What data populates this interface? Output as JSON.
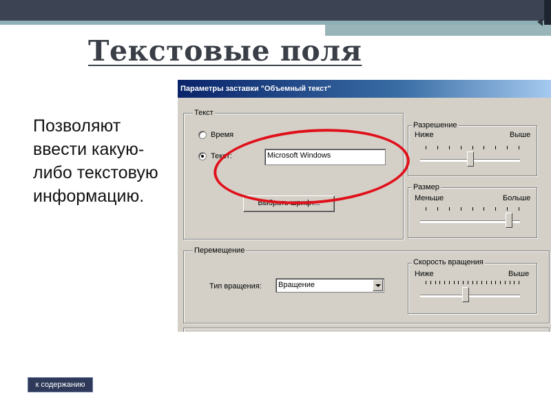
{
  "slide": {
    "title": "Текстовые поля",
    "body": "Позволяют ввести какую-либо текстовую информацию.",
    "toc_button": "к содержанию"
  },
  "dialog": {
    "title": "Параметры заставки \"Объемный текст\"",
    "text_group": {
      "label": "Текст",
      "radio_time": "Время",
      "radio_text": "Текст:",
      "radio_text_selected": true,
      "text_value": "Microsoft Windows",
      "font_button": "Выбрать шрифт..."
    },
    "resolution_group": {
      "label": "Разрешение",
      "min_label": "Ниже",
      "max_label": "Выше",
      "level": 0.5
    },
    "size_group": {
      "label": "Размер",
      "min_label": "Меньше",
      "max_label": "Больше",
      "level": 0.92
    },
    "motion_group": {
      "label": "Перемещение",
      "rotation_type_label": "Тип вращения:",
      "rotation_type_value": "Вращение"
    },
    "speed_group": {
      "label": "Скорость вращения",
      "min_label": "Ниже",
      "max_label": "Выше",
      "level": 0.45
    }
  },
  "colors": {
    "highlight": "#e0101a",
    "topbar": "#3c4352",
    "title_bar": "#0a246a"
  }
}
